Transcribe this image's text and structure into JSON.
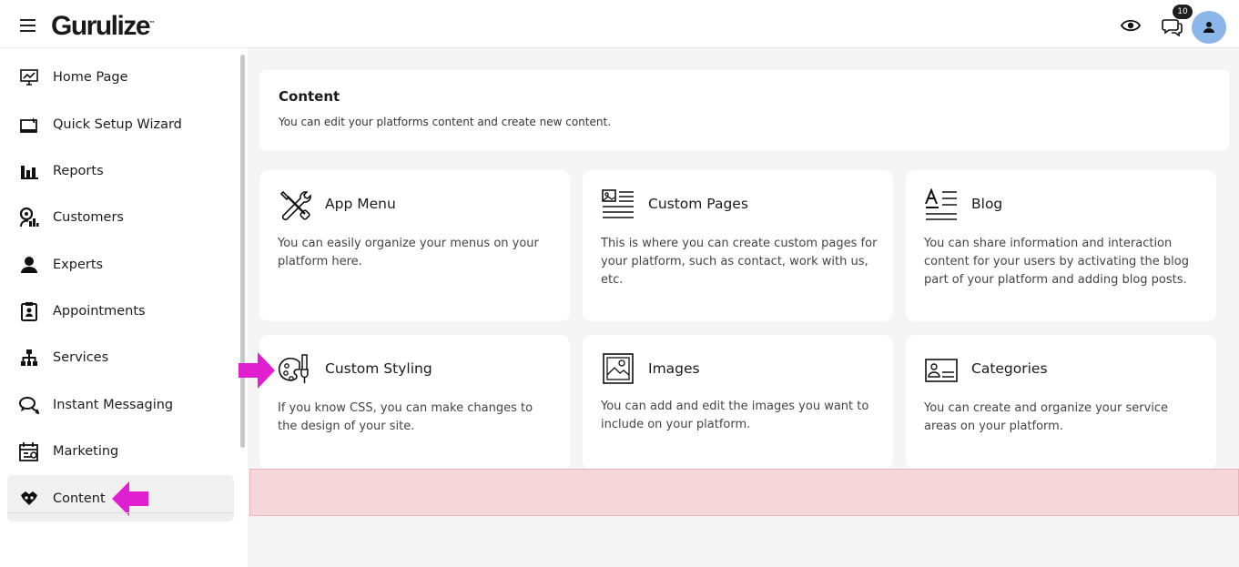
{
  "brand": {
    "name": "Gurulize",
    "mark": "™"
  },
  "topbar": {
    "notification_count": "10"
  },
  "sidebar": {
    "items": [
      {
        "label": "Home Page",
        "icon": "chart-monitor-icon"
      },
      {
        "label": "Quick Setup Wizard",
        "icon": "wizard-window-icon"
      },
      {
        "label": "Reports",
        "icon": "bar-chart-icon"
      },
      {
        "label": "Customers",
        "icon": "customer-chart-icon"
      },
      {
        "label": "Experts",
        "icon": "user-icon"
      },
      {
        "label": "Appointments",
        "icon": "clipboard-user-icon"
      },
      {
        "label": "Services",
        "icon": "sitemap-icon"
      },
      {
        "label": "Instant Messaging",
        "icon": "chat-bubbles-icon"
      },
      {
        "label": "Marketing",
        "icon": "calendar-marketing-icon"
      },
      {
        "label": "Content",
        "icon": "puzzle-hands-icon",
        "active": true
      }
    ]
  },
  "main": {
    "title": "Content",
    "subtitle": "You can edit your platforms content and create new content.",
    "cards": [
      {
        "title": "App Menu",
        "description": "You can easily organize your menus on your platform here.",
        "icon": "tools-icon"
      },
      {
        "title": "Custom Pages",
        "description": "This is where you can create custom pages for your platform, such as contact, work with us, etc.",
        "icon": "page-layout-icon"
      },
      {
        "title": "Blog",
        "description": "You can share information and interaction content for your users by activating the blog part of your platform and adding blog posts.",
        "icon": "text-article-icon"
      },
      {
        "title": "Custom Styling",
        "description": "If you know CSS, you can make changes to the design of your site.",
        "icon": "palette-brush-icon"
      },
      {
        "title": "Images",
        "description": "You can add and edit the images you want to include on your platform.",
        "icon": "image-frame-icon"
      },
      {
        "title": "Categories",
        "description": "You can create and organize your service areas on your platform.",
        "icon": "id-card-icon"
      }
    ]
  },
  "colors": {
    "accent_arrow": "#e020d0",
    "avatar": "#8ab6ea",
    "error_bar": "#f6d7d9"
  }
}
